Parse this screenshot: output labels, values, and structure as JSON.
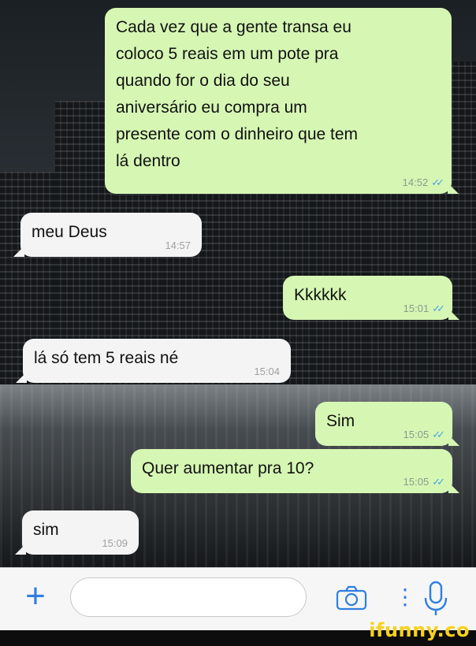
{
  "messages": [
    {
      "text": "Cada vez que a gente transa eu\ncoloco 5 reais em um pote pra\nquando for o dia do seu\naniversário eu compra um\npresente com o dinheiro que tem\nlá dentro",
      "time": "14:52",
      "direction": "out"
    },
    {
      "text": "meu Deus",
      "time": "14:57",
      "direction": "in"
    },
    {
      "text": "Kkkkkk",
      "time": "15:01",
      "direction": "out"
    },
    {
      "text": "lá só tem 5 reais né",
      "time": "15:04",
      "direction": "in"
    },
    {
      "text": "Sim",
      "time": "15:05",
      "direction": "out"
    },
    {
      "text": "Quer aumentar pra 10?",
      "time": "15:05",
      "direction": "out"
    },
    {
      "text": "sim",
      "time": "15:09",
      "direction": "in"
    }
  ],
  "read_receipt_icon": "double-check-icon",
  "input_bar": {
    "plus_icon": "plus-icon",
    "camera_icon": "camera-icon",
    "more_icon": "vertical-dots-icon",
    "mic_icon": "microphone-icon",
    "accent_color": "#2f7fe0"
  },
  "watermark": {
    "text": "ifunny.co"
  },
  "colors": {
    "outgoing_bubble": "#d6f7b4",
    "incoming_bubble": "#f4f4f4",
    "read_ticks": "#4aa3e0"
  }
}
